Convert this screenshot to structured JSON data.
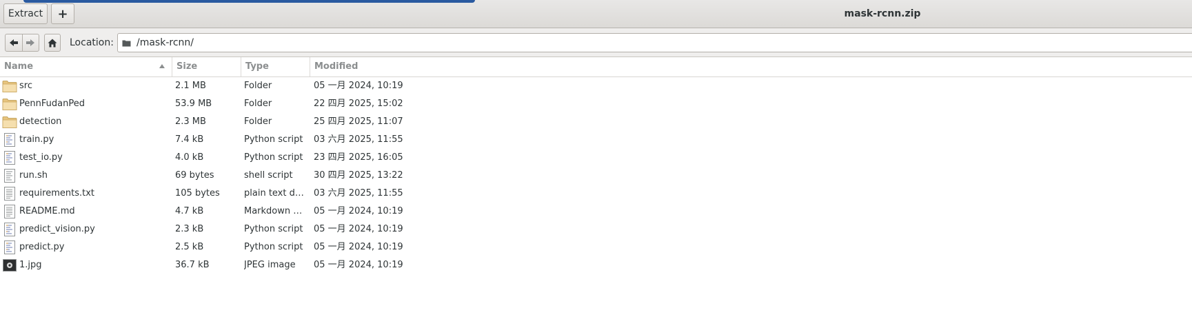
{
  "header": {
    "extract_label": "Extract",
    "add_label": "+",
    "title": "mask-rcnn.zip"
  },
  "location": {
    "label": "Location:",
    "value": "/mask-rcnn/"
  },
  "columns": {
    "name": "Name",
    "size": "Size",
    "type": "Type",
    "modified": "Modified"
  },
  "files": [
    {
      "name": "src",
      "size": "2.1 MB",
      "type": "Folder",
      "modified": "05 一月 2024, 10:19",
      "icon": "folder-icon"
    },
    {
      "name": "PennFudanPed",
      "size": "53.9 MB",
      "type": "Folder",
      "modified": "22 四月 2025, 15:02",
      "icon": "folder-icon"
    },
    {
      "name": "detection",
      "size": "2.3 MB",
      "type": "Folder",
      "modified": "25 四月 2025, 11:07",
      "icon": "folder-icon"
    },
    {
      "name": "train.py",
      "size": "7.4 kB",
      "type": "Python script",
      "modified": "03 六月 2025, 11:55",
      "icon": "python-file-icon"
    },
    {
      "name": "test_io.py",
      "size": "4.0 kB",
      "type": "Python script",
      "modified": "23 四月 2025, 16:05",
      "icon": "python-file-icon"
    },
    {
      "name": "run.sh",
      "size": "69 bytes",
      "type": "shell script",
      "modified": "30 四月 2025, 13:22",
      "icon": "script-file-icon"
    },
    {
      "name": "requirements.txt",
      "size": "105 bytes",
      "type": "plain text d…",
      "modified": "03 六月 2025, 11:55",
      "icon": "text-file-icon"
    },
    {
      "name": "README.md",
      "size": "4.7 kB",
      "type": "Markdown …",
      "modified": "05 一月 2024, 10:19",
      "icon": "text-file-icon"
    },
    {
      "name": "predict_vision.py",
      "size": "2.3 kB",
      "type": "Python script",
      "modified": "05 一月 2024, 10:19",
      "icon": "python-file-icon"
    },
    {
      "name": "predict.py",
      "size": "2.5 kB",
      "type": "Python script",
      "modified": "05 一月 2024, 10:19",
      "icon": "python-file-icon"
    },
    {
      "name": "1.jpg",
      "size": "36.7 kB",
      "type": "JPEG image",
      "modified": "05 一月 2024, 10:19",
      "icon": "image-file-icon"
    }
  ],
  "colors": {
    "accent": "#2a5aa0",
    "folder": "#f3d9a4",
    "header_text": "#8b8e8f"
  }
}
